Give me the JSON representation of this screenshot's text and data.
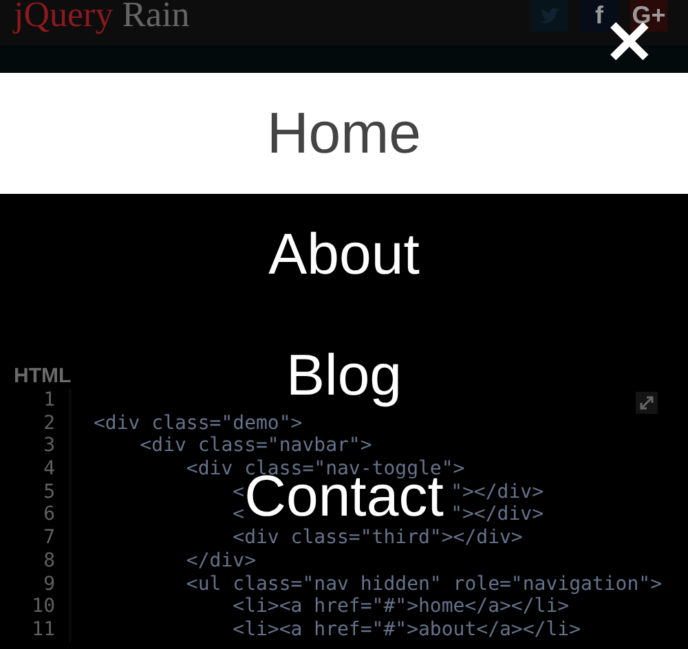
{
  "header": {
    "logo": {
      "first": "jQuery",
      "second": "Rain"
    },
    "social": [
      {
        "kind": "twitter"
      },
      {
        "kind": "text",
        "label": "f",
        "color": "#060c18"
      },
      {
        "kind": "text",
        "label": "G+",
        "color": "#2a0a08"
      }
    ]
  },
  "code_panel": {
    "title": "HTML",
    "lines": [
      {
        "number": "1"
      },
      {
        "number": "2",
        "parts": [
          "<div class=\"demo\">"
        ]
      },
      {
        "number": "3",
        "parts": [
          "    <div class=\"navbar\">"
        ]
      },
      {
        "number": "4",
        "parts": [
          "        <div class=\"nav-toggle\">"
        ]
      },
      {
        "number": "5",
        "parts": [
          "            <",
          "\"></div>"
        ]
      },
      {
        "number": "6",
        "parts": [
          "            <",
          "\"></div>"
        ]
      },
      {
        "number": "7",
        "parts": [
          "            <div class=\"third\"></div>"
        ]
      },
      {
        "number": "8",
        "parts": [
          "        </div>"
        ]
      },
      {
        "number": "9",
        "parts": [
          "        <ul class=\"nav hidden\" role=\"navigation\">"
        ]
      },
      {
        "number": "10",
        "parts": [
          "            <li><a href=\"#\">home</a></li>"
        ]
      },
      {
        "number": "11",
        "parts": [
          "            <li><a href=\"#\">about</a></li>"
        ]
      }
    ]
  },
  "menu": {
    "close": "✕",
    "items": [
      {
        "label": "Home",
        "selected": true
      },
      {
        "label": "About",
        "selected": false
      },
      {
        "label": "Blog",
        "selected": false
      },
      {
        "label": "Contact",
        "selected": false
      }
    ]
  }
}
